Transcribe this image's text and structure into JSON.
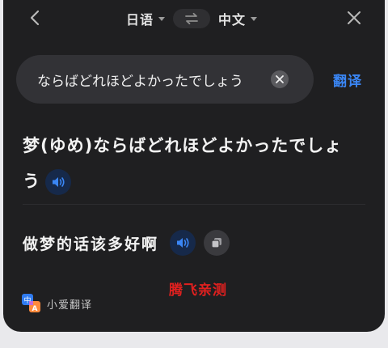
{
  "header": {
    "source_lang": "日语",
    "target_lang": "中文"
  },
  "input": {
    "value": "ならばどれほどよかったでしょう"
  },
  "translate_label": "翻译",
  "results": {
    "source_text": "梦(ゆめ)ならばどれほどよかったでしょう",
    "target_text": "做梦的话该多好啊"
  },
  "footer": {
    "brand_name": "小爱翻译",
    "watermark": "腾飞亲测"
  },
  "colors": {
    "accent": "#3a86f5",
    "background": "#1f1f21",
    "watermark": "#e0201f"
  },
  "icons": {
    "back": "chevron-left-icon",
    "swap": "swap-arrows-icon",
    "close": "close-icon",
    "clear": "clear-circle-icon",
    "speaker": "speaker-icon",
    "copy": "copy-icon",
    "logo": "xiaoai-translate-logo"
  }
}
